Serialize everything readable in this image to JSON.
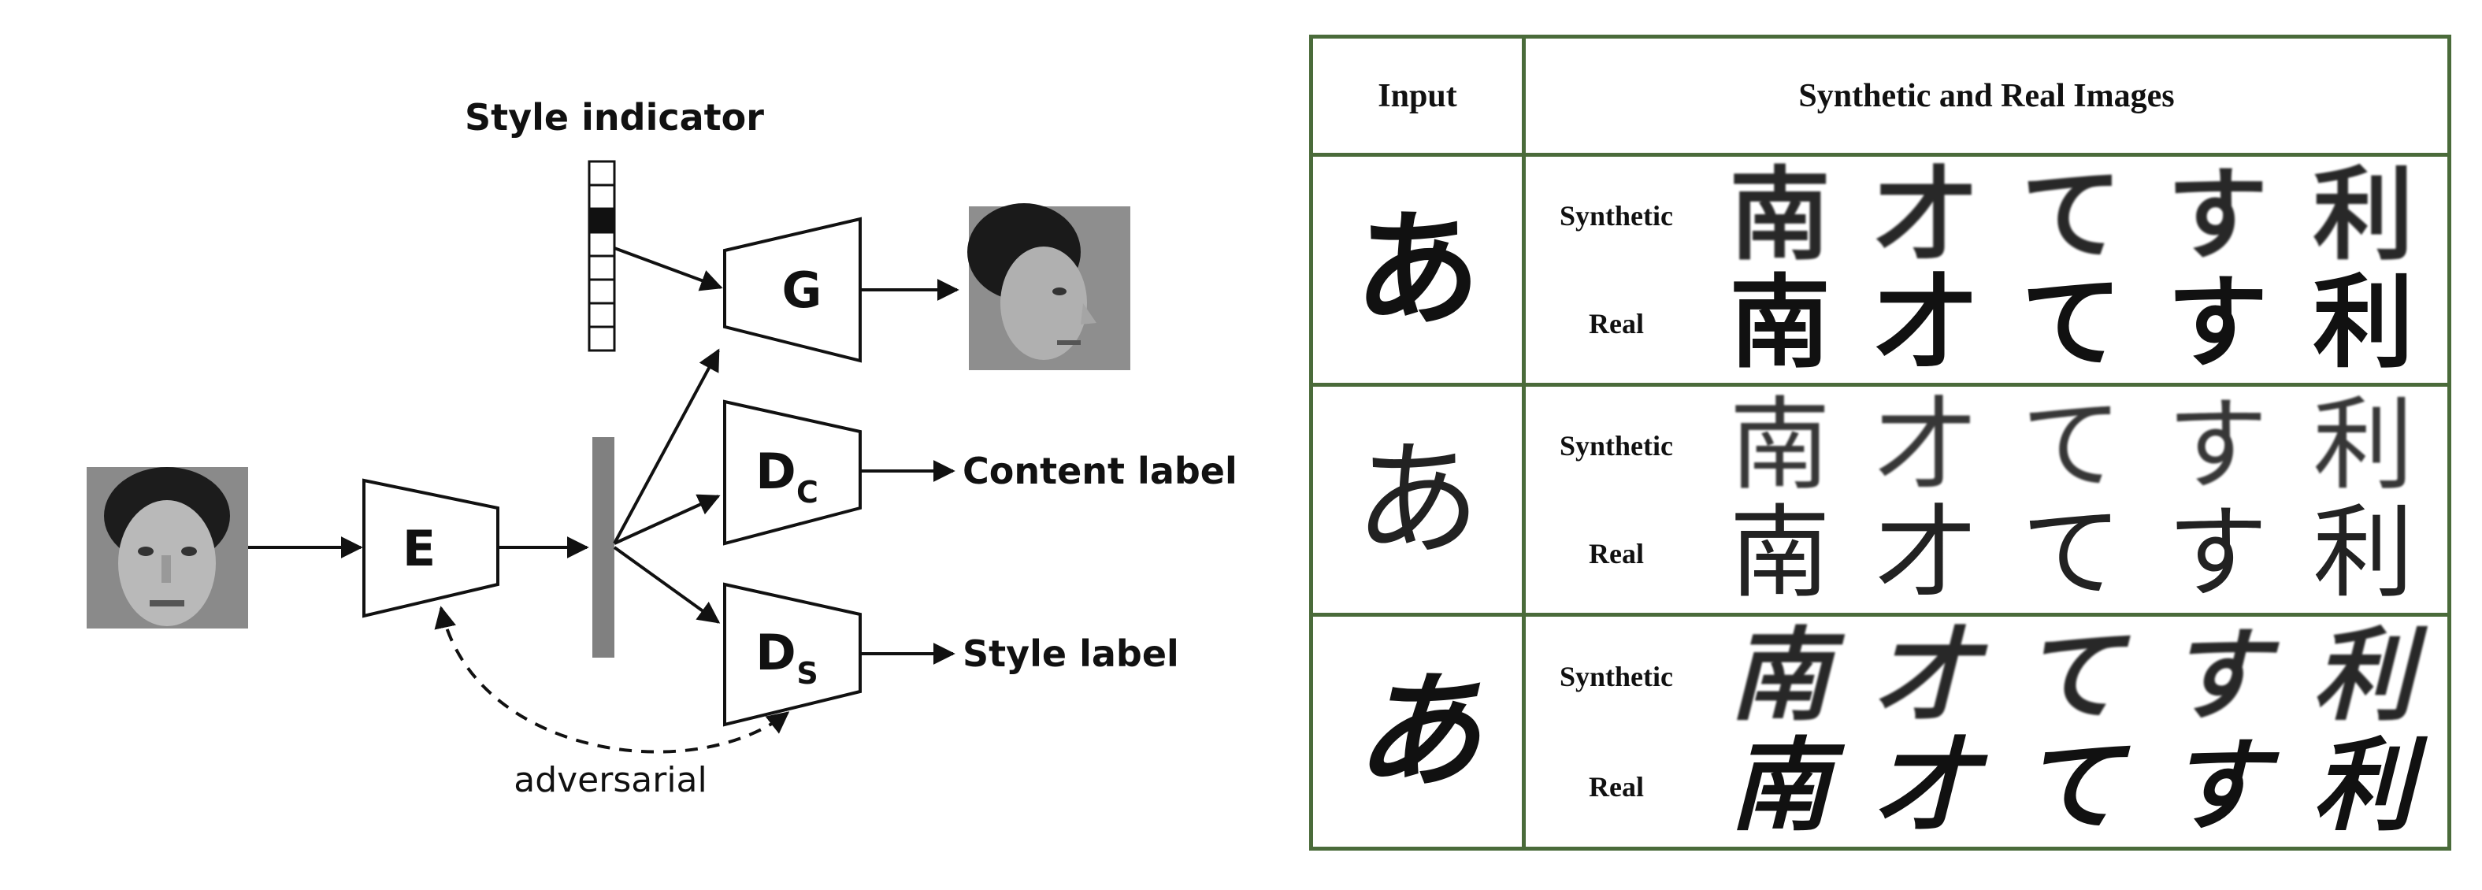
{
  "diagram": {
    "style_indicator_label": "Style indicator",
    "generator_label": "G",
    "encoder_label": "E",
    "content_discriminator": {
      "main": "D",
      "sub": "C"
    },
    "style_discriminator": {
      "main": "D",
      "sub": "S"
    },
    "content_output_label": "Content label",
    "style_output_label": "Style label",
    "adversarial_label": "adversarial"
  },
  "table": {
    "header_input": "Input",
    "header_images": "Synthetic and Real Images",
    "row_labels": {
      "synthetic": "Synthetic",
      "real": "Real"
    },
    "input_glyph": "あ",
    "sample_glyphs": [
      "南",
      "才",
      "て",
      "す",
      "利"
    ],
    "styles": [
      "bold",
      "light",
      "brush"
    ]
  }
}
